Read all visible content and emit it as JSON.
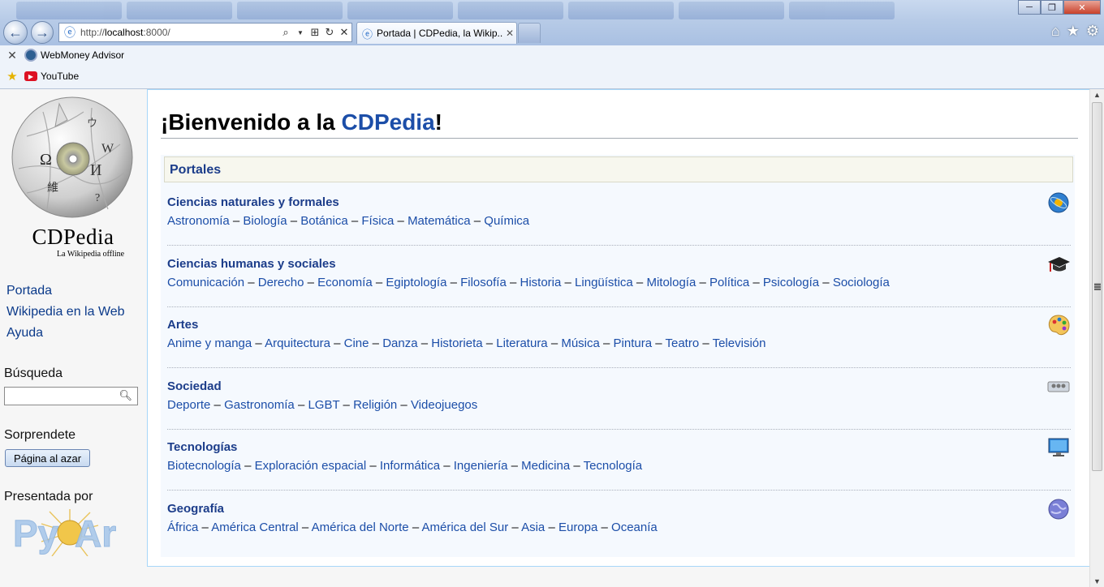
{
  "browser": {
    "url_prefix": "http://",
    "url_host": "localhost",
    "url_rest": ":8000/",
    "tab_title": "Portada | CDPedia, la Wikip...",
    "tab_close": "✕",
    "window_controls": {
      "minimize": "─",
      "maximize": "❐",
      "close": "✕"
    },
    "right_icons": [
      "home-icon",
      "star-icon",
      "gear-icon"
    ]
  },
  "favorites": {
    "row1_label": "WebMoney Advisor",
    "row2_label": "YouTube"
  },
  "sidebar": {
    "brand": "CDPedia",
    "tagline": "La Wikipedia offline",
    "nav": [
      "Portada",
      "Wikipedia en la Web",
      "Ayuda"
    ],
    "search_heading": "Búsqueda",
    "search_value": "",
    "surprise_heading": "Sorprendete",
    "random_button": "Página al azar",
    "presented_heading": "Presentada por"
  },
  "main": {
    "title_prefix": "¡Bienvenido a la ",
    "title_link": "CDPedia",
    "title_suffix": "!",
    "portals_header": "Portales",
    "portals": [
      {
        "title": "Ciencias naturales y formales",
        "icon": "atom-icon",
        "links": [
          "Astronomía",
          "Biología",
          "Botánica",
          "Física",
          "Matemática",
          "Química"
        ]
      },
      {
        "title": "Ciencias humanas y sociales",
        "icon": "graduation-cap-icon",
        "links": [
          "Comunicación",
          "Derecho",
          "Economía",
          "Egiptología",
          "Filosofía",
          "Historia",
          "Lingüística",
          "Mitología",
          "Política",
          "Psicología",
          "Sociología"
        ]
      },
      {
        "title": "Artes",
        "icon": "palette-icon",
        "links": [
          "Anime y manga",
          "Arquitectura",
          "Cine",
          "Danza",
          "Historieta",
          "Literatura",
          "Música",
          "Pintura",
          "Teatro",
          "Televisión"
        ]
      },
      {
        "title": "Sociedad",
        "icon": "people-icon",
        "links": [
          "Deporte",
          "Gastronomía",
          "LGBT",
          "Religión",
          "Videojuegos"
        ]
      },
      {
        "title": "Tecnologías",
        "icon": "computer-monitor-icon",
        "links": [
          "Biotecnología",
          "Exploración espacial",
          "Informática",
          "Ingeniería",
          "Medicina",
          "Tecnología"
        ]
      },
      {
        "title": "Geografía",
        "icon": "globe-icon",
        "links": [
          "África",
          "América Central",
          "América del Norte",
          "América del Sur",
          "Asia",
          "Europa",
          "Oceanía"
        ]
      }
    ]
  },
  "colors": {
    "link": "#1c4ea8",
    "portal_title": "#1c3d8a",
    "portal_bg": "#f5f9fe"
  }
}
